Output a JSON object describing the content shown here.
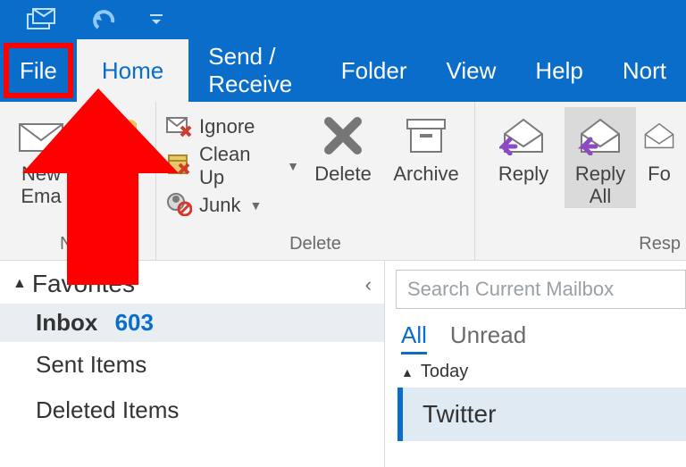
{
  "titlebar": {
    "icons": [
      "mail-stack-icon",
      "undo-icon",
      "customize-icon"
    ]
  },
  "tabs": {
    "file": "File",
    "home": "Home",
    "send_receive": "Send / Receive",
    "folder": "Folder",
    "view": "View",
    "help": "Help",
    "last_partial": "Nort"
  },
  "ribbon": {
    "group_new": {
      "label": "New",
      "new_email": "New\nEma"
    },
    "group_delete": {
      "label": "Delete",
      "ignore": "Ignore",
      "cleanup": "Clean Up",
      "junk": "Junk",
      "delete": "Delete",
      "archive": "Archive"
    },
    "group_respond": {
      "label": "Resp",
      "reply": "Reply",
      "reply_all": "Reply\nAll",
      "forward_partial": "Fo"
    }
  },
  "nav": {
    "favorites": "Favorites",
    "inbox": {
      "name": "Inbox",
      "count": "603"
    },
    "sent": "Sent Items",
    "deleted": "Deleted Items"
  },
  "mail": {
    "search_placeholder": "Search Current Mailbox",
    "filters": {
      "all": "All",
      "unread": "Unread"
    },
    "group_today": "Today",
    "message1": "Twitter"
  }
}
